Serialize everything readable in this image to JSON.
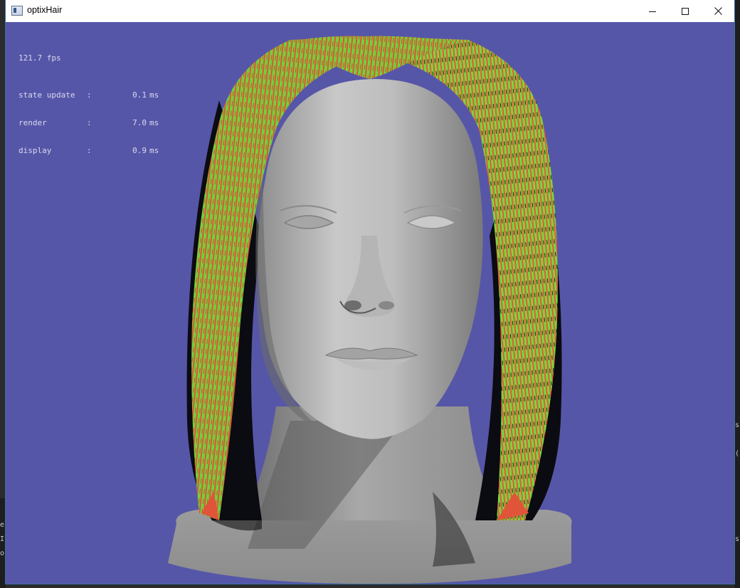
{
  "window": {
    "title": "optixHair"
  },
  "titlebar": {
    "minimize_icon": "minimize-icon",
    "maximize_icon": "maximize-icon",
    "close_icon": "close-icon"
  },
  "stats": {
    "fps": "121.7 fps",
    "rows": [
      {
        "label": "state update",
        "value": "0.1",
        "unit": "ms"
      },
      {
        "label": "render",
        "value": "7.0",
        "unit": "ms"
      },
      {
        "label": "display",
        "value": "0.9",
        "unit": "ms"
      }
    ]
  },
  "background": {
    "left_chars": [
      "e",
      "Ir",
      "or"
    ],
    "right_chars": [
      "s",
      "(",
      "s"
    ]
  },
  "colors": {
    "viewport_bg": "#5656a8",
    "hair_green": "#6fd23a",
    "hair_red": "#e0553a",
    "skin_gray": "#b9b9b9"
  }
}
